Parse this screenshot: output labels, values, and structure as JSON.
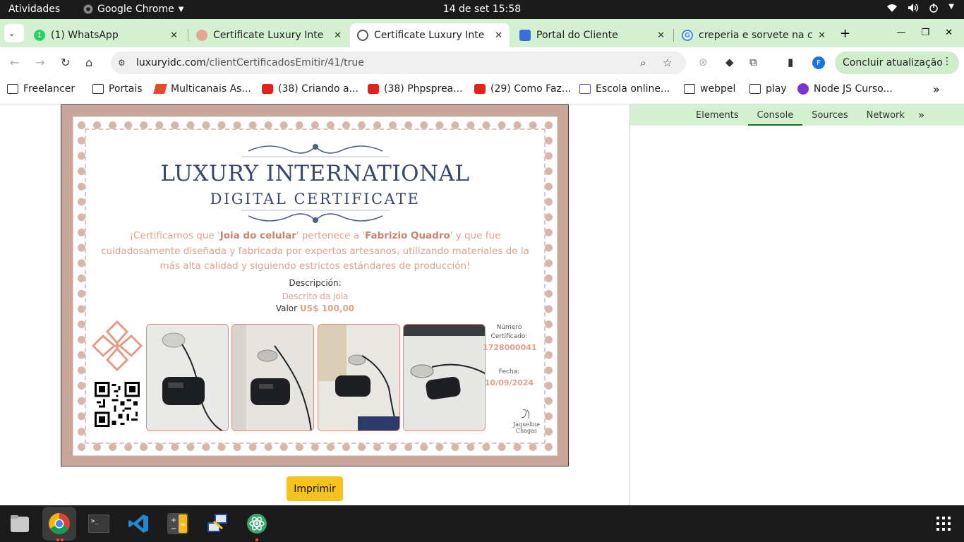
{
  "topbar": {
    "activities": "Atividades",
    "app_name": "Google Chrome",
    "clock": "14 de set  15:58"
  },
  "tabs": [
    {
      "title": "(1) WhatsApp",
      "favicon": "whatsapp-icon",
      "active": false
    },
    {
      "title": "Certificate Luxury Inte",
      "favicon": "luxury-icon",
      "active": false
    },
    {
      "title": "Certificate Luxury Inte",
      "favicon": "globe-icon",
      "active": true
    },
    {
      "title": "Portal do Cliente",
      "favicon": "portal-icon",
      "active": false
    },
    {
      "title": "creperia e sorvete na c",
      "favicon": "google-icon",
      "active": false
    }
  ],
  "toolbar": {
    "url_domain": "luxuryidc.com",
    "url_path": "/clientCertificadosEmitir/41/true",
    "profile_initial": "F",
    "update_label": "Concluir atualização"
  },
  "bookmarks": [
    {
      "label": "Freelancer",
      "icon": "folder"
    },
    {
      "label": "Portais",
      "icon": "folder"
    },
    {
      "label": "Multicanais As...",
      "icon": "red"
    },
    {
      "label": "(38) Criando a...",
      "icon": "yt"
    },
    {
      "label": "(38) Phpsprea...",
      "icon": "yt"
    },
    {
      "label": "(29) Como Faz...",
      "icon": "yt"
    },
    {
      "label": "Escola online...",
      "icon": "school"
    },
    {
      "label": "webpel",
      "icon": "folder"
    },
    {
      "label": "play",
      "icon": "folder"
    },
    {
      "label": "Node JS Curso...",
      "icon": "purple"
    }
  ],
  "devtools": {
    "tabs": [
      "Elements",
      "Console",
      "Sources",
      "Network"
    ],
    "active_tab": "Console"
  },
  "certificate": {
    "title_line1": "LUXURY INTERNATIONAL",
    "title_line2": "DIGITAL CERTIFICATE",
    "statement_pre": "¡Certificamos que '",
    "item_name": "Joia do celular",
    "statement_mid": "' pertenece a '",
    "owner_name": "Fabrizio Quadro",
    "statement_post": "' y que fue cuidadosamente diseñada y fabricada por expertos artesanos, utilizando materiales de la más alta calidad y siguiendo estrictos estándares de producción!",
    "description_label": "Descripción:",
    "description_value": "Descrito da joia",
    "value_label": "Valor",
    "value_amount": "US$ 100,00",
    "number_label": "Número Certificado:",
    "number_value": "1728000041",
    "date_label": "Fecha:",
    "date_value": "10/09/2024",
    "signature_name": "Jaqueline Chagas",
    "photo_count": 4
  },
  "actions": {
    "print_label": "Imprimir"
  },
  "colors": {
    "chrome_bg": "#d3f0d0",
    "cert_frame": "#c9a59a",
    "cert_title": "#39486b",
    "cert_accent": "#e0a08f",
    "print_button": "#f6c31c"
  }
}
